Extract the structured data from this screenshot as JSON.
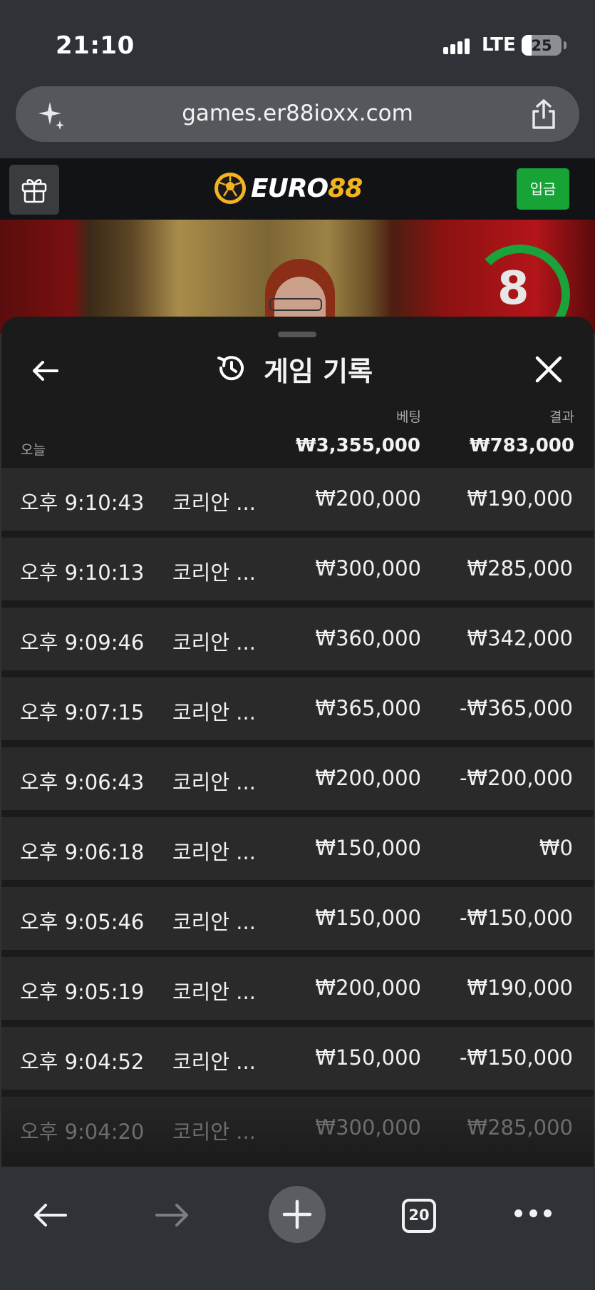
{
  "status": {
    "time": "21:10",
    "network": "LTE",
    "battery": "25"
  },
  "browser": {
    "url": "games.er88ioxx.com",
    "tab_count": "20"
  },
  "site": {
    "logo_main": "EURO",
    "logo_accent": "88",
    "deposit_label": "입금",
    "accent_color": "#f4b321",
    "deposit_color": "#17a335"
  },
  "video": {
    "timer": "8"
  },
  "history": {
    "title": "게임 기록",
    "col_bet": "베팅",
    "col_result": "결과",
    "today_label": "오늘",
    "total_bet": "₩3,355,000",
    "total_result": "₩783,000",
    "rows": [
      {
        "time": "오후 9:10:43",
        "game": "코리안 ...",
        "bet": "₩200,000",
        "result": "₩190,000"
      },
      {
        "time": "오후 9:10:13",
        "game": "코리안 ...",
        "bet": "₩300,000",
        "result": "₩285,000"
      },
      {
        "time": "오후 9:09:46",
        "game": "코리안 ...",
        "bet": "₩360,000",
        "result": "₩342,000"
      },
      {
        "time": "오후 9:07:15",
        "game": "코리안 ...",
        "bet": "₩365,000",
        "result": "-₩365,000"
      },
      {
        "time": "오후 9:06:43",
        "game": "코리안 ...",
        "bet": "₩200,000",
        "result": "-₩200,000"
      },
      {
        "time": "오후 9:06:18",
        "game": "코리안 ...",
        "bet": "₩150,000",
        "result": "₩0"
      },
      {
        "time": "오후 9:05:46",
        "game": "코리안 ...",
        "bet": "₩150,000",
        "result": "-₩150,000"
      },
      {
        "time": "오후 9:05:19",
        "game": "코리안 ...",
        "bet": "₩200,000",
        "result": "₩190,000"
      },
      {
        "time": "오후 9:04:52",
        "game": "코리안 ...",
        "bet": "₩150,000",
        "result": "-₩150,000"
      },
      {
        "time": "오후 9:04:20",
        "game": "코리안 ...",
        "bet": "₩300,000",
        "result": "₩285,000"
      }
    ]
  }
}
